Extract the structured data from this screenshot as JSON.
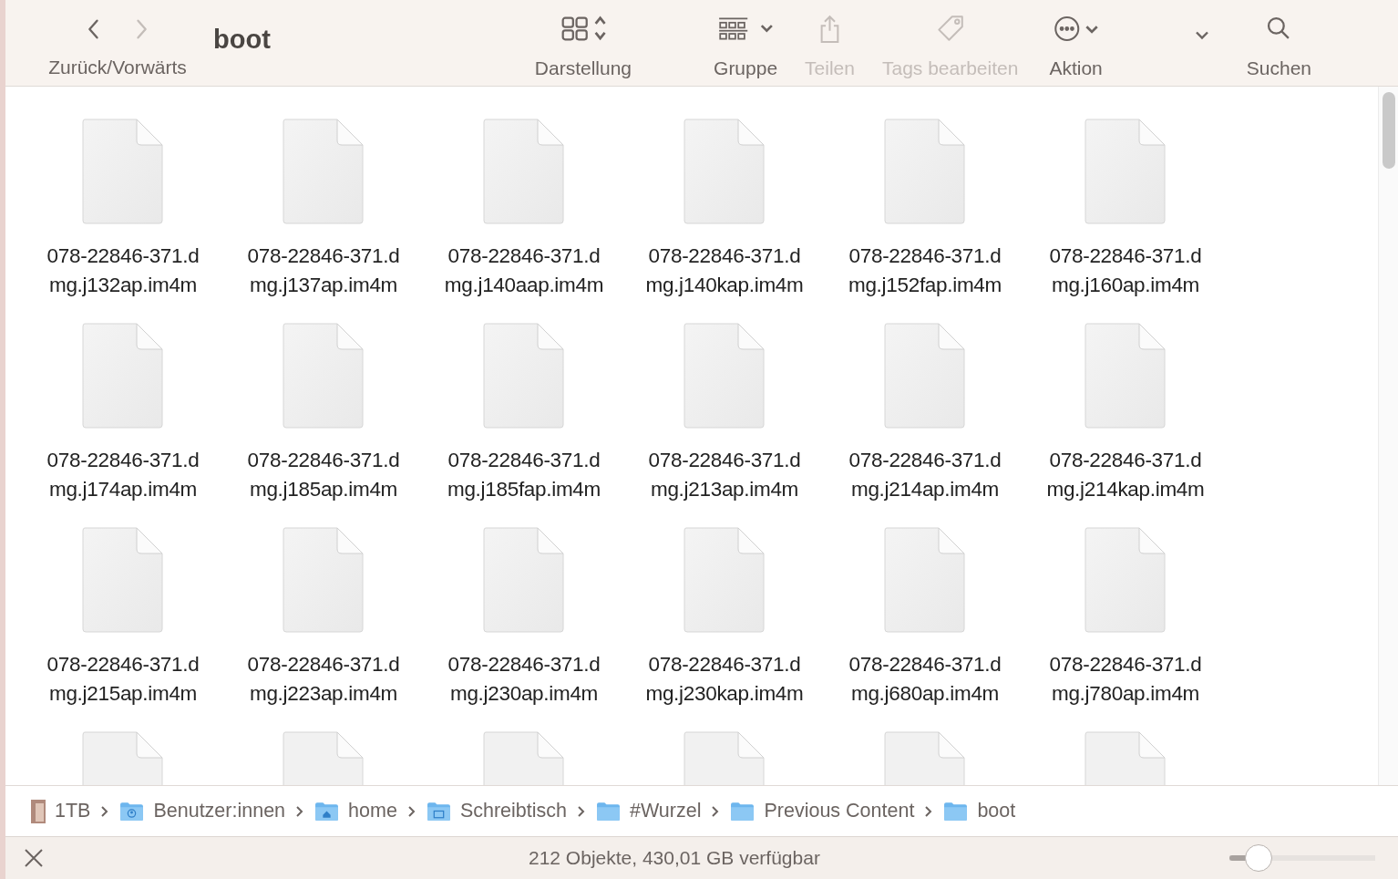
{
  "toolbar": {
    "nav_label": "Zurück/Vorwärts",
    "back_disabled": false,
    "forward_disabled": true,
    "title": "boot",
    "items": [
      {
        "kind": "view",
        "label": "Darstellung",
        "disabled": false
      },
      {
        "kind": "group",
        "label": "Gruppe",
        "disabled": false
      },
      {
        "kind": "share",
        "label": "Teilen",
        "disabled": true
      },
      {
        "kind": "tags",
        "label": "Tags bearbeiten",
        "disabled": true
      },
      {
        "kind": "action",
        "label": "Aktion",
        "disabled": false
      },
      {
        "kind": "overflow",
        "disabled": false
      },
      {
        "kind": "search",
        "label": "Suchen",
        "disabled": false
      }
    ]
  },
  "files": [
    {
      "label_lines": [
        "078-22846-371.d",
        "mg.j132ap.im4m"
      ]
    },
    {
      "label_lines": [
        "078-22846-371.d",
        "mg.j137ap.im4m"
      ]
    },
    {
      "label_lines": [
        "078-22846-371.d",
        "mg.j140aap.im4m"
      ]
    },
    {
      "label_lines": [
        "078-22846-371.d",
        "mg.j140kap.im4m"
      ]
    },
    {
      "label_lines": [
        "078-22846-371.d",
        "mg.j152fap.im4m"
      ]
    },
    {
      "label_lines": [
        "078-22846-371.d",
        "mg.j160ap.im4m"
      ]
    },
    {
      "label_lines": [
        "078-22846-371.d",
        "mg.j174ap.im4m"
      ]
    },
    {
      "label_lines": [
        "078-22846-371.d",
        "mg.j185ap.im4m"
      ]
    },
    {
      "label_lines": [
        "078-22846-371.d",
        "mg.j185fap.im4m"
      ]
    },
    {
      "label_lines": [
        "078-22846-371.d",
        "mg.j213ap.im4m"
      ]
    },
    {
      "label_lines": [
        "078-22846-371.d",
        "mg.j214ap.im4m"
      ]
    },
    {
      "label_lines": [
        "078-22846-371.d",
        "mg.j214kap.im4m"
      ]
    },
    {
      "label_lines": [
        "078-22846-371.d",
        "mg.j215ap.im4m"
      ]
    },
    {
      "label_lines": [
        "078-22846-371.d",
        "mg.j223ap.im4m"
      ]
    },
    {
      "label_lines": [
        "078-22846-371.d",
        "mg.j230ap.im4m"
      ]
    },
    {
      "label_lines": [
        "078-22846-371.d",
        "mg.j230kap.im4m"
      ]
    },
    {
      "label_lines": [
        "078-22846-371.d",
        "mg.j680ap.im4m"
      ]
    },
    {
      "label_lines": [
        "078-22846-371.d",
        "mg.j780ap.im4m"
      ]
    }
  ],
  "path_bar": [
    {
      "kind": "drive",
      "label": "1TB"
    },
    {
      "kind": "user-folder",
      "label": "Benutzer:innen"
    },
    {
      "kind": "home-folder",
      "label": "home"
    },
    {
      "kind": "desktop-folder",
      "label": "Schreibtisch"
    },
    {
      "kind": "folder",
      "label": "#Wurzel"
    },
    {
      "kind": "folder",
      "label": "Previous Content"
    },
    {
      "kind": "folder",
      "label": "boot"
    }
  ],
  "status_bar": {
    "text": "212 Objekte, 430,01 GB verfügbar",
    "icon_size": {
      "level": 0.2
    }
  }
}
